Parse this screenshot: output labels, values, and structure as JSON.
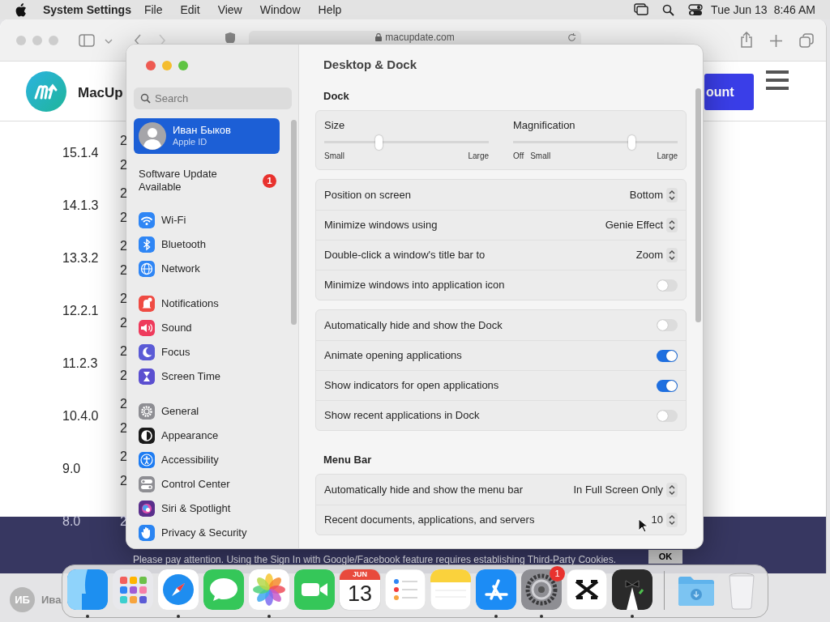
{
  "menu_bar": {
    "app_name": "System Settings",
    "menus": [
      "File",
      "Edit",
      "View",
      "Window",
      "Help"
    ],
    "date": "Tue Jun 13",
    "time": "8:46 AM"
  },
  "browser": {
    "address": "macupdate.com",
    "site_name": "MacUp",
    "account_button": "ount",
    "rows": [
      {
        "version": "15.1.4",
        "column_2": [
          "2",
          "2"
        ]
      },
      {
        "version": "14.1.3",
        "column_2": [
          "2",
          "2"
        ]
      },
      {
        "version": "13.3.2",
        "column_2": [
          "2",
          "2"
        ]
      },
      {
        "version": "12.2.1",
        "column_2": [
          "2",
          "2"
        ]
      },
      {
        "version": "11.2.3",
        "column_2": [
          "2",
          "2"
        ]
      },
      {
        "version": "10.4.0",
        "column_2": [
          "2",
          "2"
        ]
      },
      {
        "version": "9.0",
        "column_2": [
          "2",
          "2"
        ]
      },
      {
        "version": "8.0",
        "column_2": [
          "2"
        ]
      }
    ],
    "notice": "Please pay attention. Using the Sign In with Google/Facebook feature requires establishing Third-Party Cookies.",
    "notice_button": "OK"
  },
  "desktop": {
    "user_initials": "ИБ",
    "user_name": "Ива"
  },
  "settings": {
    "search": {
      "placeholder": "Search"
    },
    "account": {
      "name": "Иван Быков",
      "subtitle": "Apple ID",
      "selected": true
    },
    "update": {
      "label": "Software Update Available",
      "badge": "1"
    },
    "groups": [
      [
        {
          "label": "Wi-Fi",
          "color": "#2f86f5",
          "selected": false
        },
        {
          "label": "Bluetooth",
          "color": "#2f86f5",
          "selected": false
        },
        {
          "label": "Network",
          "color": "#2f86f5",
          "selected": false
        }
      ],
      [
        {
          "label": "Notifications",
          "color": "#ef4b43",
          "selected": false
        },
        {
          "label": "Sound",
          "color": "#ee3b5c",
          "selected": false
        },
        {
          "label": "Focus",
          "color": "#5b5bd6",
          "selected": false
        },
        {
          "label": "Screen Time",
          "color": "#5b4fd0",
          "selected": false
        }
      ],
      [
        {
          "label": "General",
          "color": "#8e8e93",
          "selected": false
        },
        {
          "label": "Appearance",
          "color": "#1a1a1a",
          "selected": false
        },
        {
          "label": "Accessibility",
          "color": "#1e7cf2",
          "selected": false
        },
        {
          "label": "Control Center",
          "color": "#8e8e93",
          "selected": false
        },
        {
          "label": "Siri & Spotlight",
          "color": "#5a2f8c",
          "selected": false
        },
        {
          "label": "Privacy & Security",
          "color": "#2a84f2",
          "selected": false
        }
      ]
    ],
    "title": "Desktop & Dock",
    "sections": [
      {
        "heading": "Dock",
        "groups": [
          [
            {
              "kind": "sliders",
              "sliders": [
                {
                  "label": "Size",
                  "level": 0.33,
                  "ticks": [
                    "Small",
                    "Large"
                  ]
                },
                {
                  "label": "Magnification",
                  "level": 0.72,
                  "ticks": [
                    "Off",
                    "Small",
                    "Large"
                  ]
                }
              ]
            }
          ],
          [
            {
              "kind": "popup",
              "label": "Position on screen",
              "value": "Bottom"
            },
            {
              "kind": "popup",
              "label": "Minimize windows using",
              "value": "Genie Effect"
            },
            {
              "kind": "popup",
              "label": "Double-click a window's title bar to",
              "value": "Zoom"
            },
            {
              "kind": "toggle",
              "label": "Minimize windows into application icon",
              "on": false
            }
          ],
          [
            {
              "kind": "toggle",
              "label": "Automatically hide and show the Dock",
              "on": false
            },
            {
              "kind": "toggle",
              "label": "Animate opening applications",
              "on": true
            },
            {
              "kind": "toggle",
              "label": "Show indicators for open applications",
              "on": true
            },
            {
              "kind": "toggle",
              "label": "Show recent applications in Dock",
              "on": false
            }
          ]
        ]
      },
      {
        "heading": "Menu Bar",
        "groups": [
          [
            {
              "kind": "popup",
              "label": "Automatically hide and show the menu bar",
              "value": "In Full Screen Only"
            },
            {
              "kind": "popup",
              "label": "Recent documents, applications, and servers",
              "value": "10"
            }
          ]
        ]
      }
    ]
  },
  "dock": {
    "apps": [
      {
        "running": true
      },
      {
        "running": false
      },
      {
        "running": true
      },
      {
        "running": false
      },
      {
        "running": true
      },
      {
        "running": false
      },
      {
        "running": false,
        "month": "JUN",
        "day": "13"
      },
      {
        "running": false
      },
      {
        "running": false
      },
      {
        "running": true
      },
      {
        "running": true,
        "badge": "1"
      },
      {
        "running": false
      },
      {
        "running": true
      }
    ]
  }
}
